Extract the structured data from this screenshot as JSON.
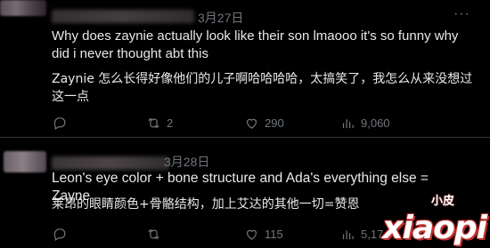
{
  "posts": [
    {
      "date": "3月27日",
      "more": "···",
      "text_en": "Why does zaynie actually look like their son lmaooo it's so funny why did i never thought abt this",
      "text_zh": "Zaynie 怎么长得好像他们的儿子啊哈哈哈哈，太搞笑了，我怎么从来没想过这一点",
      "actions": {
        "reply": "",
        "repost": "2",
        "like": "290",
        "views": "9,060"
      }
    },
    {
      "date": "3月28日",
      "text_en": "Leon's eye color + bone structure and Ada's everything else = Zayne",
      "text_zh": "莱昂的眼睛颜色+骨骼结构，加上艾达的其他一切=赞恩",
      "actions": {
        "reply": "",
        "repost": "",
        "like": "115",
        "views": "5,17"
      }
    }
  ],
  "watermark": {
    "small": "小皮",
    "big": "xiaopi"
  },
  "icons": [
    "more-icon",
    "reply-icon",
    "repost-icon",
    "like-icon",
    "views-icon"
  ]
}
